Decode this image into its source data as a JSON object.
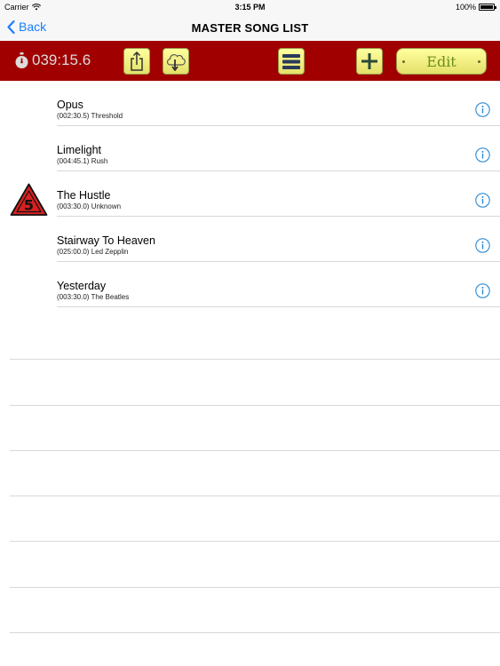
{
  "status_bar": {
    "carrier": "Carrier",
    "time": "3:15 PM",
    "battery": "100%",
    "battery_level": 1.0
  },
  "nav": {
    "back_label": "Back",
    "title": "MASTER SONG LIST"
  },
  "toolbar": {
    "timer": "039:15.6",
    "edit_label": "Edit",
    "accent_color": "#a10000",
    "button_color": "#f3f08a",
    "icons": [
      "stopwatch-icon",
      "share-icon",
      "cloud-download-icon",
      "menu-icon",
      "plus-icon"
    ]
  },
  "songs": [
    {
      "title": "Opus",
      "meta": "(002:30.5) Threshold",
      "warning": false
    },
    {
      "title": "Limelight",
      "meta": "(004:45.1) Rush",
      "warning": false
    },
    {
      "title": "The Hustle",
      "meta": "(003:30.0) Unknown",
      "warning": true,
      "warning_label": "5"
    },
    {
      "title": "Stairway To Heaven",
      "meta": "(025:00.0) Led Zepplin",
      "warning": false
    },
    {
      "title": "Yesterday",
      "meta": "(003:30.0) The Beatles",
      "warning": false
    }
  ],
  "colors": {
    "link": "#1a7dff",
    "info": "#2a8ad4",
    "warning_fill": "#d82020"
  }
}
